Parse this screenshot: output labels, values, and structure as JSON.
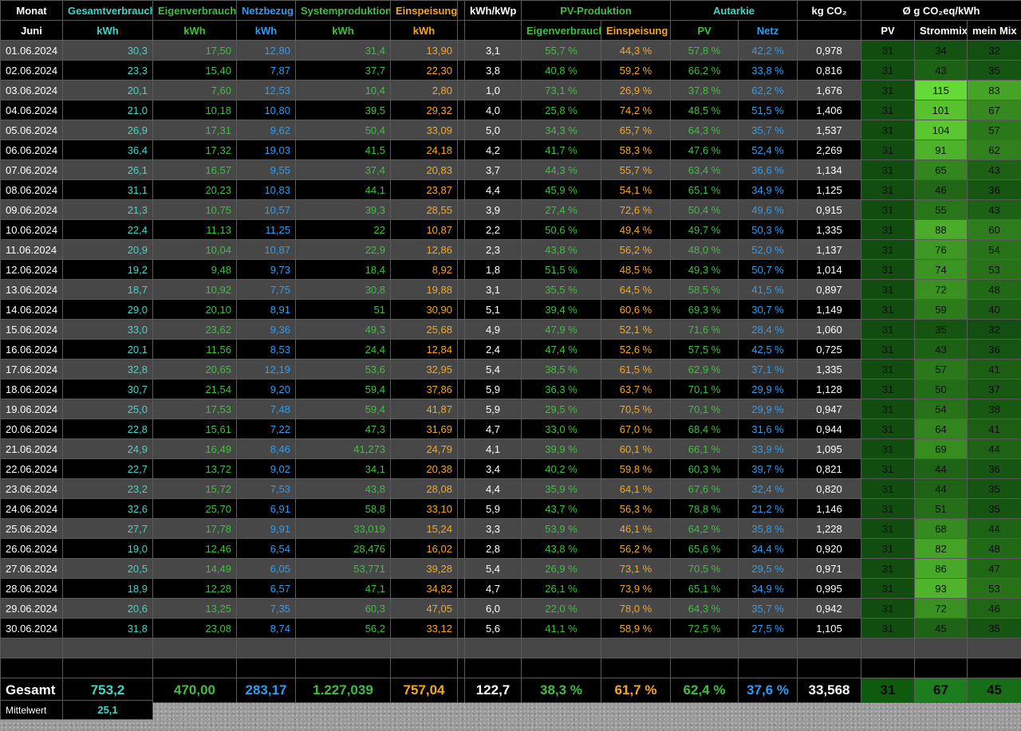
{
  "header": {
    "monat": "Monat",
    "gesamtverbrauch": "Gesamtverbrauch",
    "eigenverbrauch": "Eigenverbrauch",
    "netzbezug": "Netzbezug",
    "systemproduktion": "Systemproduktion",
    "einspeisung": "Einspeisung",
    "kwh_kwp": "kWh/kWp",
    "pv_produktion": "PV-Produktion",
    "autarkie": "Autarkie",
    "kg_co2": "kg CO₂",
    "co2_avg": "Ø g CO₂eq/kWh"
  },
  "subheader": {
    "month": "Juni",
    "unit_gv": "kWh",
    "unit_ev": "kWh",
    "unit_nb": "kWh",
    "unit_sp": "kWh",
    "unit_es": "kWh",
    "pv_eigen": "Eigenverbrauch",
    "pv_einsp": "Einspeisung",
    "aut_pv": "PV",
    "aut_netz": "Netz",
    "co2_pv": "PV",
    "co2_mix": "Strommix",
    "co2_mein": "mein Mix"
  },
  "colors": {
    "cyan": "#3fd6c8",
    "green": "#3fbf3f",
    "blue": "#2f9cf0",
    "orange": "#f5a623"
  },
  "rows": [
    [
      "01.06.2024",
      "30,3",
      "17,50",
      "12,80",
      "31,4",
      "13,90",
      "3,1",
      "55,7 %",
      "44,3 %",
      "57,8 %",
      "42,2 %",
      "0,978",
      "31",
      "34",
      "32"
    ],
    [
      "02.06.2024",
      "23,3",
      "15,40",
      "7,87",
      "37,7",
      "22,30",
      "3,8",
      "40,8 %",
      "59,2 %",
      "66,2 %",
      "33,8 %",
      "0,816",
      "31",
      "43",
      "35"
    ],
    [
      "03.06.2024",
      "20,1",
      "7,60",
      "12,53",
      "10,4",
      "2,80",
      "1,0",
      "73,1 %",
      "26,9 %",
      "37,8 %",
      "62,2 %",
      "1,676",
      "31",
      "115",
      "83"
    ],
    [
      "04.06.2024",
      "21,0",
      "10,18",
      "10,80",
      "39,5",
      "29,32",
      "4,0",
      "25,8 %",
      "74,2 %",
      "48,5 %",
      "51,5 %",
      "1,406",
      "31",
      "101",
      "67"
    ],
    [
      "05.06.2024",
      "26,9",
      "17,31",
      "9,62",
      "50,4",
      "33,09",
      "5,0",
      "34,3 %",
      "65,7 %",
      "64,3 %",
      "35,7 %",
      "1,537",
      "31",
      "104",
      "57"
    ],
    [
      "06.06.2024",
      "36,4",
      "17,32",
      "19,03",
      "41,5",
      "24,18",
      "4,2",
      "41,7 %",
      "58,3 %",
      "47,6 %",
      "52,4 %",
      "2,269",
      "31",
      "91",
      "62"
    ],
    [
      "07.06.2024",
      "26,1",
      "16,57",
      "9,55",
      "37,4",
      "20,83",
      "3,7",
      "44,3 %",
      "55,7 %",
      "63,4 %",
      "36,6 %",
      "1,134",
      "31",
      "65",
      "43"
    ],
    [
      "08.06.2024",
      "31,1",
      "20,23",
      "10,83",
      "44,1",
      "23,87",
      "4,4",
      "45,9 %",
      "54,1 %",
      "65,1 %",
      "34,9 %",
      "1,125",
      "31",
      "46",
      "36"
    ],
    [
      "09.06.2024",
      "21,3",
      "10,75",
      "10,57",
      "39,3",
      "28,55",
      "3,9",
      "27,4 %",
      "72,6 %",
      "50,4 %",
      "49,6 %",
      "0,915",
      "31",
      "55",
      "43"
    ],
    [
      "10.06.2024",
      "22,4",
      "11,13",
      "11,25",
      "22",
      "10,87",
      "2,2",
      "50,6 %",
      "49,4 %",
      "49,7 %",
      "50,3 %",
      "1,335",
      "31",
      "88",
      "60"
    ],
    [
      "11.06.2024",
      "20,9",
      "10,04",
      "10,87",
      "22,9",
      "12,86",
      "2,3",
      "43,8 %",
      "56,2 %",
      "48,0 %",
      "52,0 %",
      "1,137",
      "31",
      "76",
      "54"
    ],
    [
      "12.06.2024",
      "19,2",
      "9,48",
      "9,73",
      "18,4",
      "8,92",
      "1,8",
      "51,5 %",
      "48,5 %",
      "49,3 %",
      "50,7 %",
      "1,014",
      "31",
      "74",
      "53"
    ],
    [
      "13.06.2024",
      "18,7",
      "10,92",
      "7,75",
      "30,8",
      "19,88",
      "3,1",
      "35,5 %",
      "64,5 %",
      "58,5 %",
      "41,5 %",
      "0,897",
      "31",
      "72",
      "48"
    ],
    [
      "14.06.2024",
      "29,0",
      "20,10",
      "8,91",
      "51",
      "30,90",
      "5,1",
      "39,4 %",
      "60,6 %",
      "69,3 %",
      "30,7 %",
      "1,149",
      "31",
      "59",
      "40"
    ],
    [
      "15.06.2024",
      "33,0",
      "23,62",
      "9,36",
      "49,3",
      "25,68",
      "4,9",
      "47,9 %",
      "52,1 %",
      "71,6 %",
      "28,4 %",
      "1,060",
      "31",
      "35",
      "32"
    ],
    [
      "16.06.2024",
      "20,1",
      "11,56",
      "8,53",
      "24,4",
      "12,84",
      "2,4",
      "47,4 %",
      "52,6 %",
      "57,5 %",
      "42,5 %",
      "0,725",
      "31",
      "43",
      "36"
    ],
    [
      "17.06.2024",
      "32,8",
      "20,65",
      "12,19",
      "53,6",
      "32,95",
      "5,4",
      "38,5 %",
      "61,5 %",
      "62,9 %",
      "37,1 %",
      "1,335",
      "31",
      "57",
      "41"
    ],
    [
      "18.06.2024",
      "30,7",
      "21,54",
      "9,20",
      "59,4",
      "37,86",
      "5,9",
      "36,3 %",
      "63,7 %",
      "70,1 %",
      "29,9 %",
      "1,128",
      "31",
      "50",
      "37"
    ],
    [
      "19.06.2024",
      "25,0",
      "17,53",
      "7,48",
      "59,4",
      "41,87",
      "5,9",
      "29,5 %",
      "70,5 %",
      "70,1 %",
      "29,9 %",
      "0,947",
      "31",
      "54",
      "38"
    ],
    [
      "20.06.2024",
      "22,8",
      "15,61",
      "7,22",
      "47,3",
      "31,69",
      "4,7",
      "33,0 %",
      "67,0 %",
      "68,4 %",
      "31,6 %",
      "0,944",
      "31",
      "64",
      "41"
    ],
    [
      "21.06.2024",
      "24,9",
      "16,49",
      "8,46",
      "41,273",
      "24,79",
      "4,1",
      "39,9 %",
      "60,1 %",
      "66,1 %",
      "33,9 %",
      "1,095",
      "31",
      "69",
      "44"
    ],
    [
      "22.06.2024",
      "22,7",
      "13,72",
      "9,02",
      "34,1",
      "20,38",
      "3,4",
      "40,2 %",
      "59,8 %",
      "60,3 %",
      "39,7 %",
      "0,821",
      "31",
      "44",
      "36"
    ],
    [
      "23.06.2024",
      "23,2",
      "15,72",
      "7,53",
      "43,8",
      "28,08",
      "4,4",
      "35,9 %",
      "64,1 %",
      "67,6 %",
      "32,4 %",
      "0,820",
      "31",
      "44",
      "35"
    ],
    [
      "24.06.2024",
      "32,6",
      "25,70",
      "6,91",
      "58,8",
      "33,10",
      "5,9",
      "43,7 %",
      "56,3 %",
      "78,8 %",
      "21,2 %",
      "1,146",
      "31",
      "51",
      "35"
    ],
    [
      "25.06.2024",
      "27,7",
      "17,78",
      "9,91",
      "33,019",
      "15,24",
      "3,3",
      "53,9 %",
      "46,1 %",
      "64,2 %",
      "35,8 %",
      "1,228",
      "31",
      "68",
      "44"
    ],
    [
      "26.06.2024",
      "19,0",
      "12,46",
      "6,54",
      "28,476",
      "16,02",
      "2,8",
      "43,8 %",
      "56,2 %",
      "65,6 %",
      "34,4 %",
      "0,920",
      "31",
      "82",
      "48"
    ],
    [
      "27.06.2024",
      "20,5",
      "14,49",
      "6,05",
      "53,771",
      "39,28",
      "5,4",
      "26,9 %",
      "73,1 %",
      "70,5 %",
      "29,5 %",
      "0,971",
      "31",
      "86",
      "47"
    ],
    [
      "28.06.2024",
      "18,9",
      "12,28",
      "6,57",
      "47,1",
      "34,82",
      "4,7",
      "26,1 %",
      "73,9 %",
      "65,1 %",
      "34,9 %",
      "0,995",
      "31",
      "93",
      "53"
    ],
    [
      "29.06.2024",
      "20,6",
      "13,25",
      "7,35",
      "60,3",
      "47,05",
      "6,0",
      "22,0 %",
      "78,0 %",
      "64,3 %",
      "35,7 %",
      "0,942",
      "31",
      "72",
      "46"
    ],
    [
      "30.06.2024",
      "31,8",
      "23,08",
      "8,74",
      "56,2",
      "33,12",
      "5,6",
      "41,1 %",
      "58,9 %",
      "72,5 %",
      "27,5 %",
      "1,105",
      "31",
      "45",
      "35"
    ]
  ],
  "totals": {
    "label": "Gesamt",
    "gv": "753,2",
    "ev": "470,00",
    "nb": "283,17",
    "sp": "1.227,039",
    "es": "757,04",
    "kwp": "122,7",
    "pv_eigen": "38,3 %",
    "pv_einsp": "61,7 %",
    "aut_pv": "62,4 %",
    "aut_netz": "37,6 %",
    "co2": "33,568",
    "g_pv": "31",
    "g_mix": "67",
    "g_mein": "45"
  },
  "average": {
    "label": "Mittelwert",
    "value": "25,1"
  }
}
